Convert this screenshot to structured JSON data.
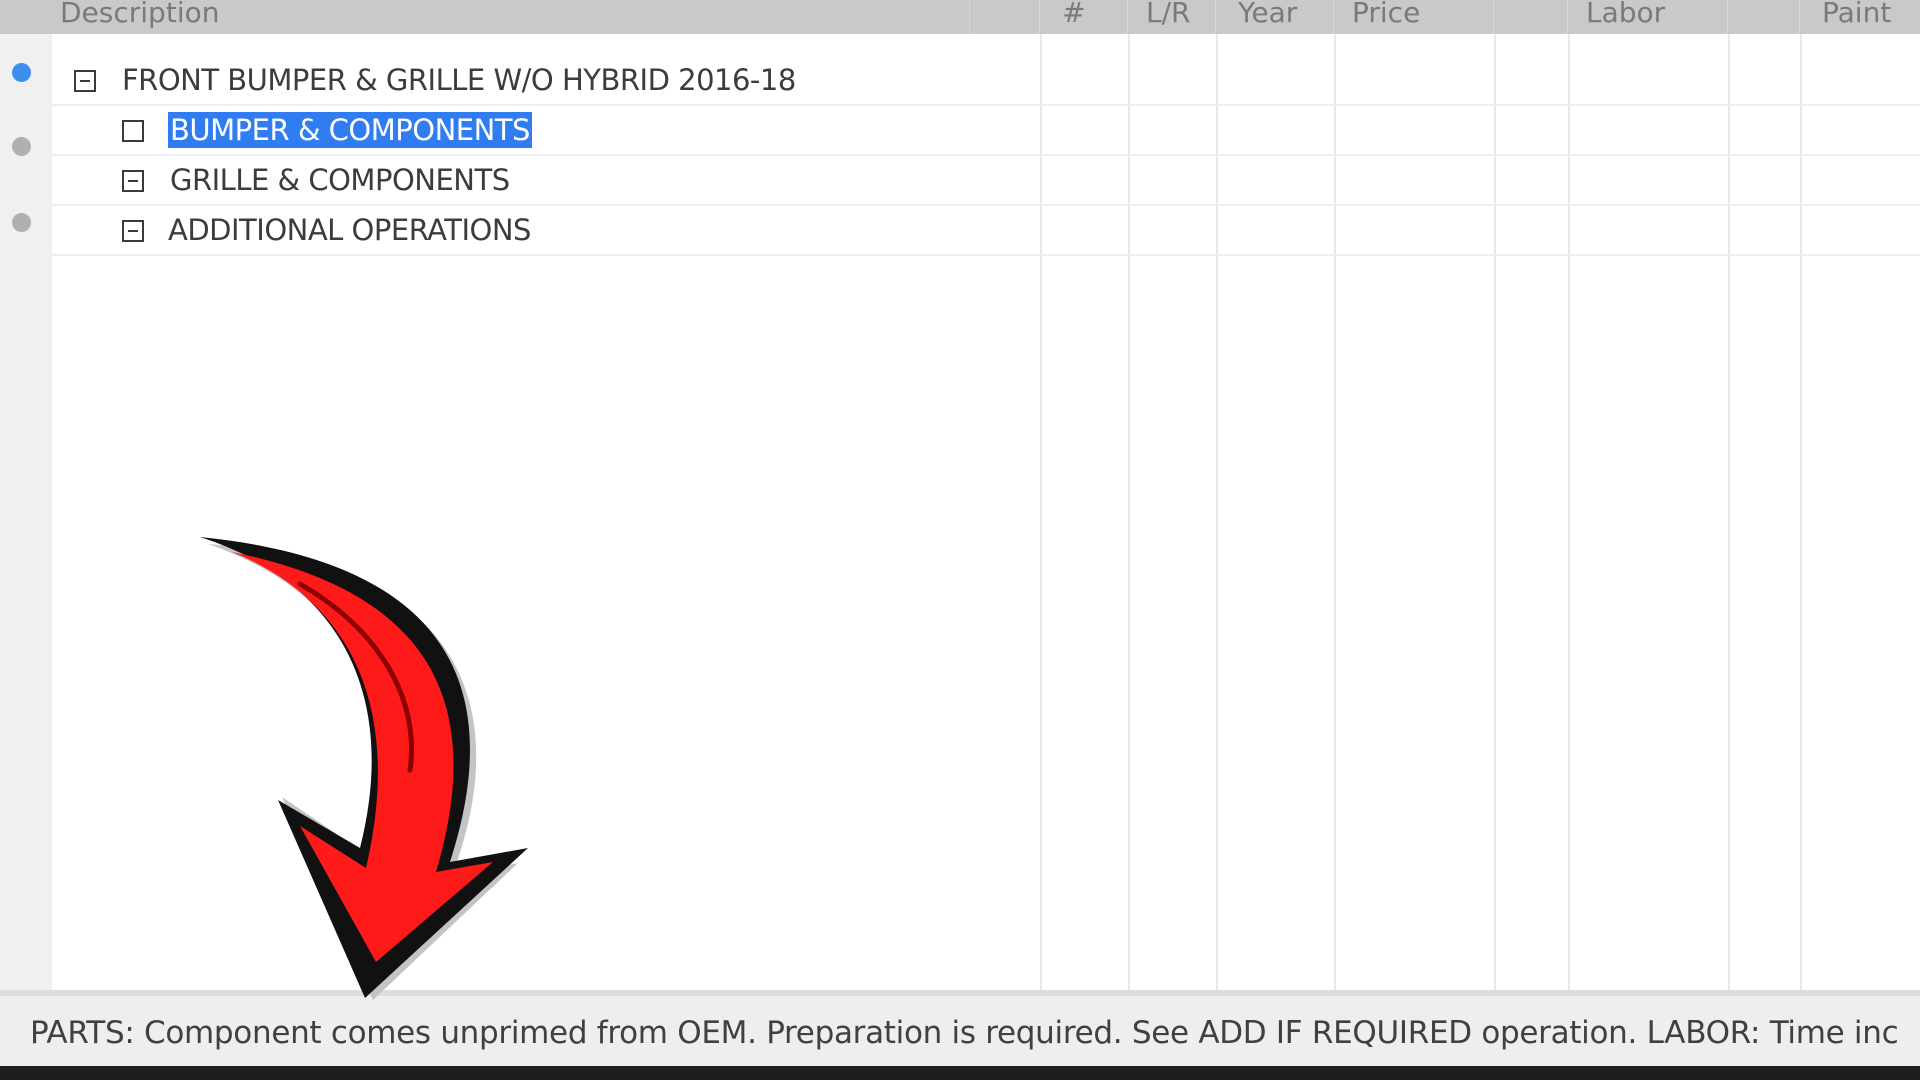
{
  "columns": {
    "description": "Description",
    "number": "#",
    "lr": "L/R",
    "year": "Year",
    "price": "Price",
    "labor": "Labor",
    "paint": "Paint"
  },
  "tree": {
    "parent": "FRONT BUMPER & GRILLE W/O HYBRID 2016-18",
    "children": [
      "BUMPER & COMPONENTS",
      "GRILLE & COMPONENTS",
      "ADDITIONAL OPERATIONS"
    ]
  },
  "status": {
    "text": "PARTS: Component comes unprimed from OEM. Preparation is required. See ADD IF REQUIRED operation. LABOR: Time inc"
  },
  "colors": {
    "selection": "#2f7df0",
    "active_dot": "#3d8ef0",
    "arrow": "#ff1a1a"
  },
  "icons": {
    "expander": "minus-box-icon",
    "annotation": "curved-arrow-down-icon"
  }
}
